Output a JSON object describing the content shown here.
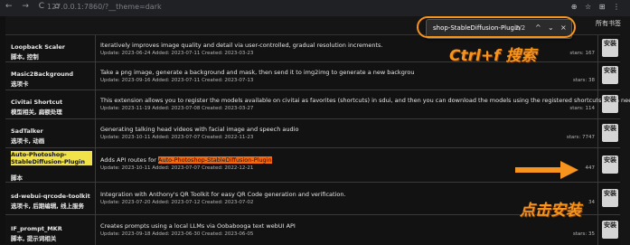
{
  "browser": {
    "nav_icons": "← → C ⌂",
    "url": "127.0.0.1:7860/?__theme=dark",
    "toolbar_icons": "⊕ ☆ ⊞ ⋮",
    "find": {
      "query": "shop-StableDiffusion-Plugin",
      "count": "2/2",
      "up": "^",
      "down": "⌄",
      "close": "×"
    },
    "right_text": "所有书签"
  },
  "annotations": {
    "ctrlf": "Ctrl+f 搜索",
    "click_install": "点击安装",
    "accent": "#f7941d"
  },
  "rows": [
    {
      "name": "Loopback Scaler",
      "tags": "脚本, 控制",
      "desc": "Iteratively improves image quality and detail via user-controlled, gradual resolution increments.",
      "meta": "Update: 2023-06-24 Added: 2023-07-11 Created: 2023-03-23",
      "stars": "stars: 167",
      "button": "安装"
    },
    {
      "name": "Masic2Background",
      "tags": "选项卡",
      "desc": "Take a png image, generate a background and mask, then send it to img2img to generate a new backgrou",
      "meta": "Update: 2023-09-16 Added: 2023-07-11 Created: 2023-07-13",
      "stars": "stars: 38",
      "button": "安装"
    },
    {
      "name": "Civitai Shortcut",
      "tags": "模型相关, 扁额处理",
      "desc": "This extension allows you to register the models available on civitai as favorites (shortcuts) in sdui, and then you can download the models using the registered shortcuts when needed.",
      "meta": "Update: 2023-11-19 Added: 2023-07-08 Created: 2023-03-27",
      "stars": "stars: 114",
      "button": "安装"
    },
    {
      "name": "SadTalker",
      "tags": "选项卡, 动画",
      "desc": "Generating talking head videos with facial image and speech audio",
      "meta": "Update: 2023-10-11 Added: 2023-07-07 Created: 2022-11-23",
      "stars": "stars: 7747",
      "button": "安装"
    },
    {
      "name": "Auto-Photoshop-StableDiffusion-Plugin",
      "tags": "脚本",
      "desc_prefix": "Adds API routes for ",
      "desc_highlight": "Auto-Photoshop-StableDiffusion-Plugin",
      "meta": "Update: 2023-10-11 Added: 2023-07-07 Created: 2022-12-21",
      "stars": "447",
      "button": "安装"
    },
    {
      "name": "sd-webui-qrcode-toolkit",
      "tags": "选项卡, 后期编辑, 线上服务",
      "desc": "Integration with Anthony's QR Toolkit for easy QR Code generation and verification.",
      "meta": "Update: 2023-07-20 Added: 2023-07-12 Created: 2023-07-02",
      "stars": "34",
      "button": "安装"
    },
    {
      "name": "IF_prompt_MKR",
      "tags": "脚本, 提示词相关",
      "desc": "Creates prompts using a local LLMs via Oobabooga text webUI API",
      "meta": "Update: 2023-09-18 Added: 2023-06-30 Created: 2023-06-05",
      "stars": "stars: 35",
      "button": "安装"
    }
  ]
}
